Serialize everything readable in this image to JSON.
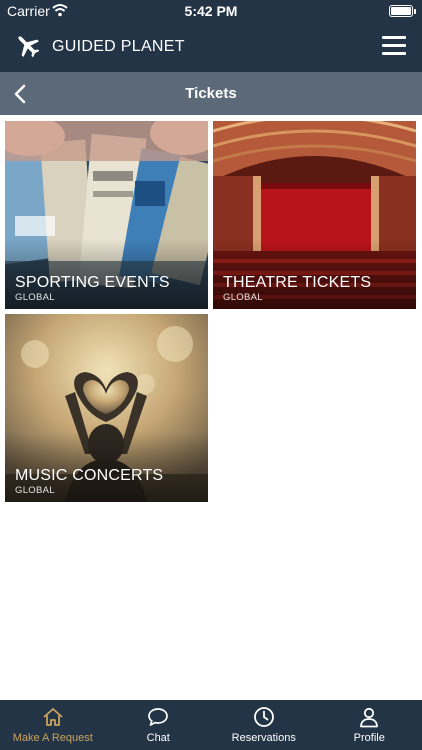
{
  "status_bar": {
    "carrier": "Carrier",
    "time": "5:42 PM"
  },
  "header": {
    "brand": "GUIDED PLANET",
    "logo_icon": "airplane-icon",
    "menu_icon": "hamburger-menu-icon"
  },
  "sub_header": {
    "title": "Tickets",
    "back_icon": "chevron-left-icon"
  },
  "tiles": [
    {
      "title": "SPORTING EVENTS",
      "subtitle": "GLOBAL"
    },
    {
      "title": "THEATRE TICKETS",
      "subtitle": "GLOBAL"
    },
    {
      "title": "MUSIC CONCERTS",
      "subtitle": "GLOBAL"
    }
  ],
  "tabbar": {
    "active_color": "#c8a35e",
    "tabs": [
      {
        "label": "Make A Request",
        "icon": "home-icon",
        "active": true
      },
      {
        "label": "Chat",
        "icon": "chat-bubble-icon",
        "active": false
      },
      {
        "label": "Reservations",
        "icon": "clock-icon",
        "active": false
      },
      {
        "label": "Profile",
        "icon": "user-icon",
        "active": false
      }
    ]
  },
  "colors": {
    "nav_bg": "#243447",
    "subheader_bg": "#5b6978"
  }
}
